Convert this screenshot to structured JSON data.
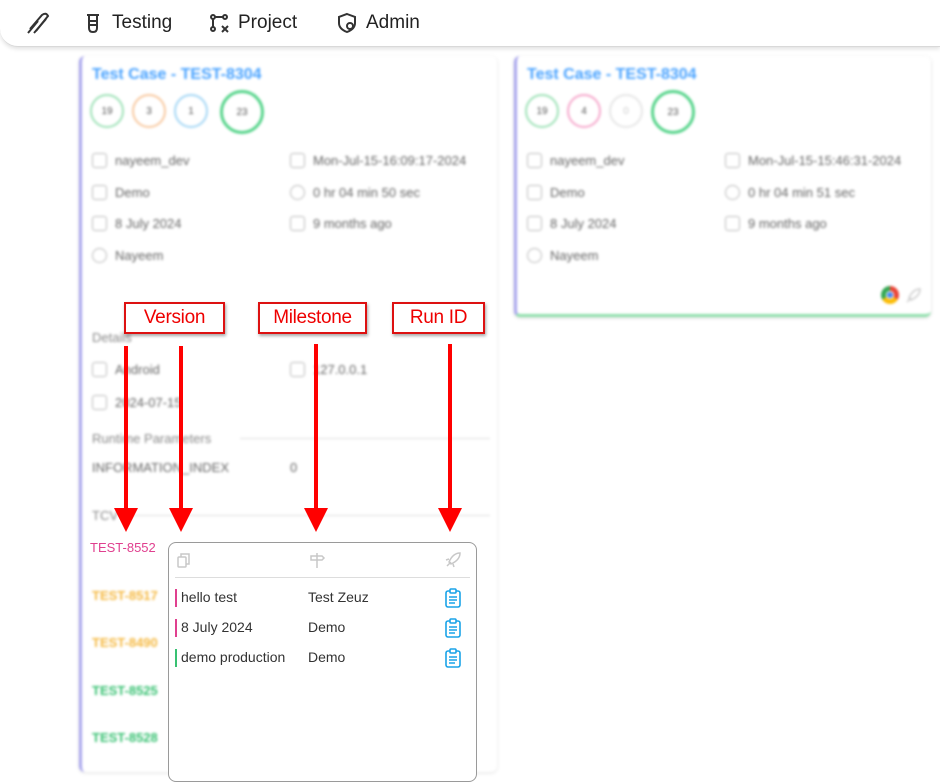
{
  "nav": {
    "items": [
      {
        "label": "Testing",
        "icon": "test-tube-icon"
      },
      {
        "label": "Project",
        "icon": "project-flow-icon"
      },
      {
        "label": "Admin",
        "icon": "admin-shield-icon"
      }
    ]
  },
  "cards": [
    {
      "title": "Test Case - TEST-8304",
      "counts": [
        "19",
        "3",
        "1",
        "23"
      ],
      "user": "nayeem_dev",
      "run_time": "Mon-Jul-15-16:09:17-2024",
      "milestone": "Demo",
      "duration": "0 hr 04 min 50 sec",
      "version": "8 July 2024",
      "ago": "9 months ago",
      "assignee": "Nayeem"
    },
    {
      "title": "Test Case - TEST-8304",
      "counts": [
        "19",
        "4",
        "0",
        "23"
      ],
      "user": "nayeem_dev",
      "run_time": "Mon-Jul-15-15:46:31-2024",
      "milestone": "Demo",
      "duration": "0 hr 04 min 51 sec",
      "version": "8 July 2024",
      "ago": "9 months ago",
      "assignee": "Nayeem"
    }
  ],
  "details": {
    "heading": "Details",
    "device": "Android",
    "ip": "127.0.0.1",
    "date": "2024-07-15",
    "runtime_heading": "Runtime Parameters",
    "param_name": "INFORMATION_INDEX",
    "param_value": "0",
    "tc_heading": "TCV"
  },
  "test_cases": [
    {
      "id": "TEST-8552",
      "color": "#e0408f"
    },
    {
      "id": "TEST-8517",
      "color": "#f5b942"
    },
    {
      "id": "TEST-8490",
      "color": "#f5b942"
    },
    {
      "id": "TEST-8525",
      "color": "#38c172"
    },
    {
      "id": "TEST-8528",
      "color": "#38c172"
    }
  ],
  "popup": {
    "rows": [
      {
        "version": "hello test",
        "milestone": "Test Zeuz",
        "color": "#e0408f"
      },
      {
        "version": "8 July 2024",
        "milestone": "Demo",
        "color": "#e0408f"
      },
      {
        "version": "demo production",
        "milestone": "Demo",
        "color": "#38c172"
      }
    ]
  },
  "annotations": {
    "version": "Version",
    "milestone": "Milestone",
    "run_id": "Run ID"
  }
}
